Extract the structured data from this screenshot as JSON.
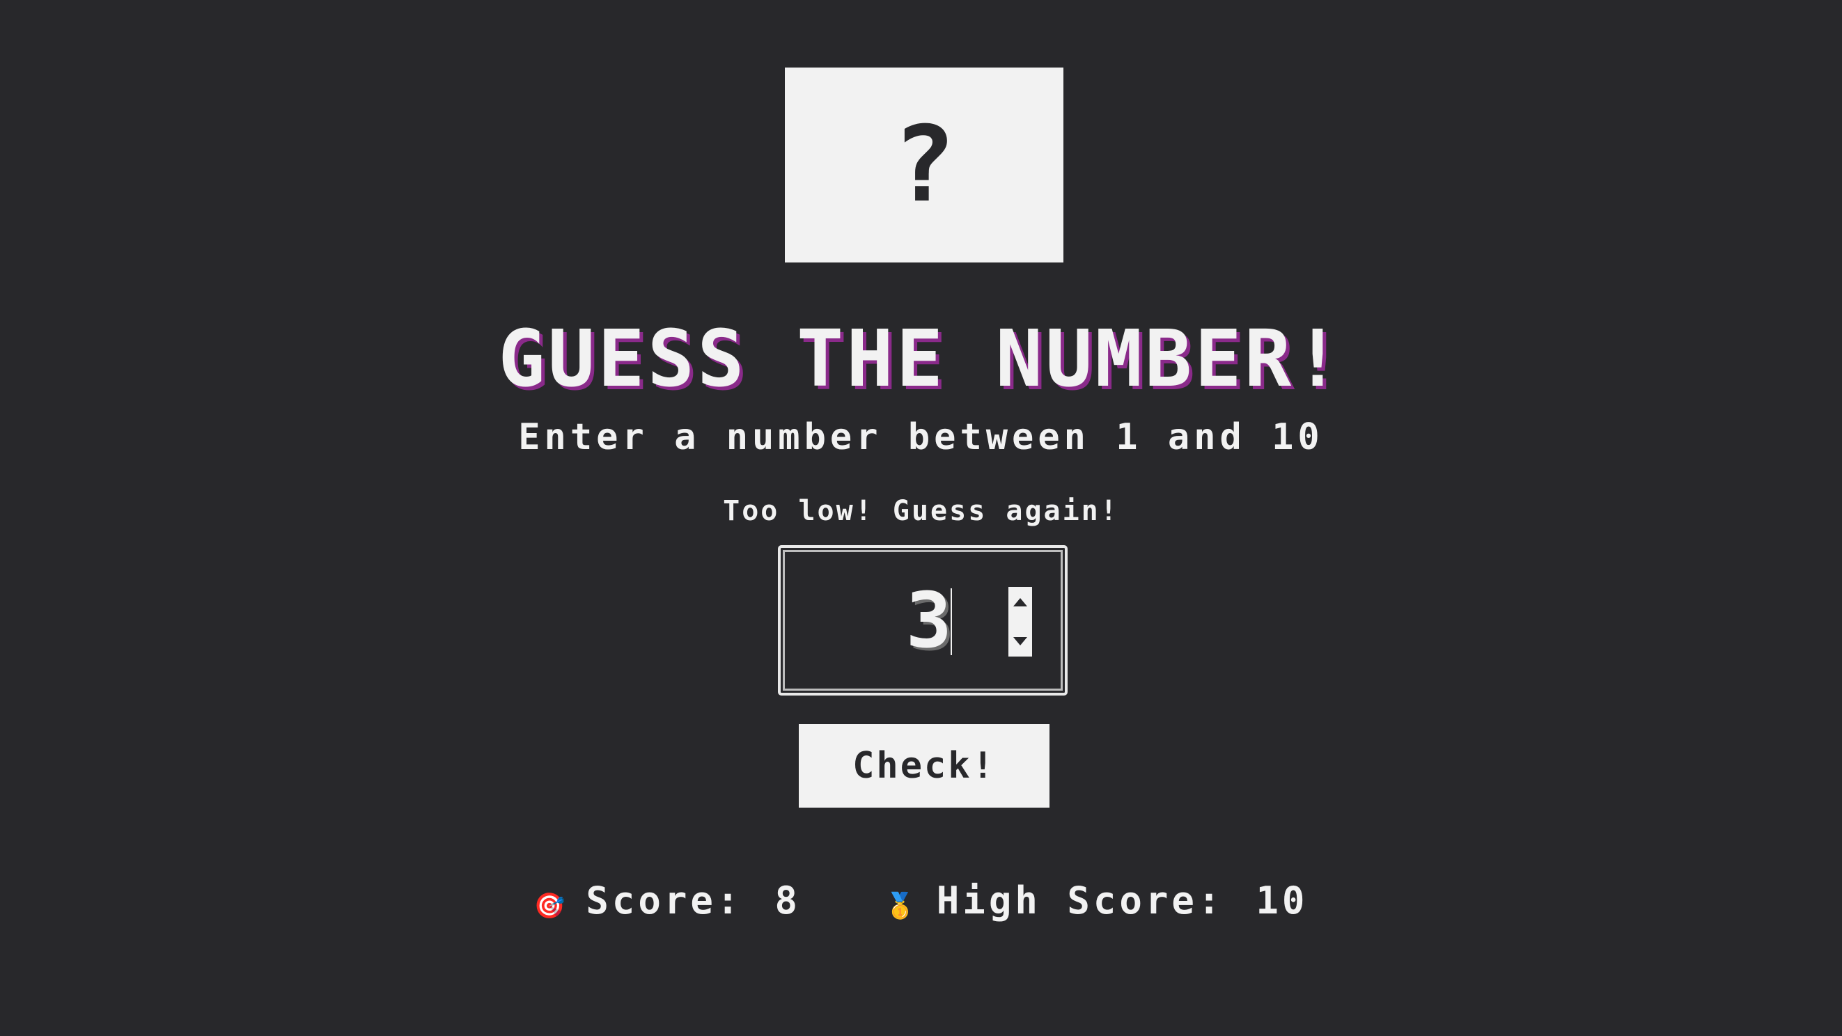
{
  "mystery": {
    "text": "?"
  },
  "title": "GUESS THE NUMBER!",
  "subtitle": "Enter a number between 1 and 10",
  "message": "Too low! Guess again!",
  "guess": {
    "value": "3"
  },
  "check_button": {
    "label": "Check!"
  },
  "score": {
    "icon": "🎯",
    "label": "Score:",
    "value": "8"
  },
  "high_score": {
    "icon": "🥇",
    "label": "High Score:",
    "value": "10"
  },
  "colors": {
    "background": "#28282b",
    "foreground": "#f2f2f2",
    "title_shadow": "#8a2a8a"
  }
}
